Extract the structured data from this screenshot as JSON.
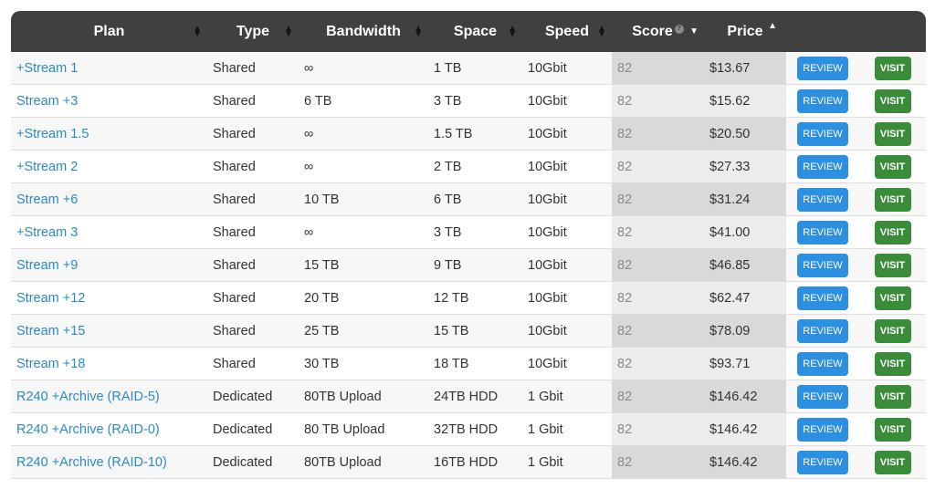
{
  "table": {
    "columns": [
      {
        "label": "Plan",
        "sort": "unsorted"
      },
      {
        "label": "Type",
        "sort": "unsorted"
      },
      {
        "label": "Bandwidth",
        "sort": "unsorted"
      },
      {
        "label": "Space",
        "sort": "unsorted"
      },
      {
        "label": "Speed",
        "sort": "unsorted"
      },
      {
        "label": "Score",
        "sort": "descending",
        "has_info_icon": true
      },
      {
        "label": "Price",
        "sort": "ascending"
      }
    ],
    "icons": {
      "sort_both": "⇕",
      "sort_up": "▲",
      "sort_down": "▼",
      "info": "?"
    },
    "buttons": {
      "review_label": "REVIEW",
      "visit_label": "VISIT"
    },
    "colors": {
      "header_bg": "#404040",
      "link": "#2b8ac6",
      "review": "#2d8fe0",
      "visit": "#3a8b3a"
    },
    "rows": [
      {
        "plan": "+Stream 1",
        "type": "Shared",
        "bandwidth": "∞",
        "space": "1 TB",
        "speed": "10Gbit",
        "score": "82",
        "price": "$13.67"
      },
      {
        "plan": "Stream +3",
        "type": "Shared",
        "bandwidth": "6 TB",
        "space": "3 TB",
        "speed": "10Gbit",
        "score": "82",
        "price": "$15.62"
      },
      {
        "plan": "+Stream 1.5",
        "type": "Shared",
        "bandwidth": "∞",
        "space": "1.5 TB",
        "speed": "10Gbit",
        "score": "82",
        "price": "$20.50"
      },
      {
        "plan": "+Stream 2",
        "type": "Shared",
        "bandwidth": "∞",
        "space": "2 TB",
        "speed": "10Gbit",
        "score": "82",
        "price": "$27.33"
      },
      {
        "plan": "Stream +6",
        "type": "Shared",
        "bandwidth": "10 TB",
        "space": "6 TB",
        "speed": "10Gbit",
        "score": "82",
        "price": "$31.24"
      },
      {
        "plan": "+Stream 3",
        "type": "Shared",
        "bandwidth": "∞",
        "space": "3 TB",
        "speed": "10Gbit",
        "score": "82",
        "price": "$41.00"
      },
      {
        "plan": "Stream +9",
        "type": "Shared",
        "bandwidth": "15 TB",
        "space": "9 TB",
        "speed": "10Gbit",
        "score": "82",
        "price": "$46.85"
      },
      {
        "plan": "Stream +12",
        "type": "Shared",
        "bandwidth": "20 TB",
        "space": "12 TB",
        "speed": "10Gbit",
        "score": "82",
        "price": "$62.47"
      },
      {
        "plan": "Stream +15",
        "type": "Shared",
        "bandwidth": "25 TB",
        "space": "15 TB",
        "speed": "10Gbit",
        "score": "82",
        "price": "$78.09"
      },
      {
        "plan": "Stream +18",
        "type": "Shared",
        "bandwidth": "30 TB",
        "space": "18 TB",
        "speed": "10Gbit",
        "score": "82",
        "price": "$93.71"
      },
      {
        "plan": "R240 +Archive (RAID-5)",
        "type": "Dedicated",
        "bandwidth": "80TB Upload",
        "space": "24TB HDD",
        "speed": "1 Gbit",
        "score": "82",
        "price": "$146.42"
      },
      {
        "plan": "R240 +Archive (RAID-0)",
        "type": "Dedicated",
        "bandwidth": "80 TB Upload",
        "space": "32TB HDD",
        "speed": "1 Gbit",
        "score": "82",
        "price": "$146.42"
      },
      {
        "plan": "R240 +Archive (RAID-10)",
        "type": "Dedicated",
        "bandwidth": "80TB Upload",
        "space": "16TB HDD",
        "speed": "1 Gbit",
        "score": "82",
        "price": "$146.42"
      }
    ]
  }
}
